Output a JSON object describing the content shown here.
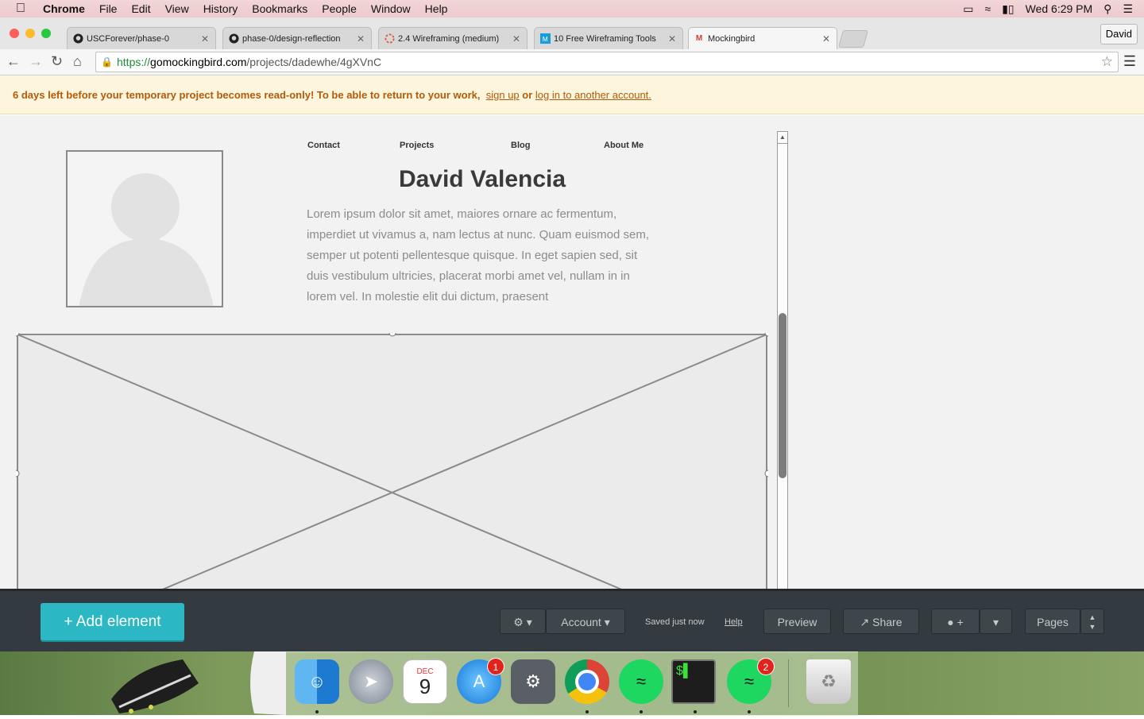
{
  "menubar": {
    "app": "Chrome",
    "items": [
      "File",
      "Edit",
      "View",
      "History",
      "Bookmarks",
      "People",
      "Window",
      "Help"
    ],
    "clock": "Wed 6:29 PM"
  },
  "tabs": [
    {
      "title": "USCForever/phase-0"
    },
    {
      "title": "phase-0/design-reflection"
    },
    {
      "title": "2.4 Wireframing (medium)"
    },
    {
      "title": "10 Free Wireframing Tools"
    },
    {
      "title": "Mockingbird"
    }
  ],
  "profile": "David",
  "address": {
    "scheme": "https://",
    "host": "gomockingbird.com",
    "path": "/projects/dadewhe/4gXVnC"
  },
  "banner": {
    "message": "6 days left before your temporary project becomes read-only! To be able to return to your work,",
    "signup": "sign up",
    "or": "or",
    "login": "log in to another account."
  },
  "wireframe": {
    "nav": [
      "Contact",
      "Projects",
      "Blog",
      "About Me"
    ],
    "name": "David Valencia",
    "bio": "Lorem ipsum dolor sit amet, maiores ornare ac fermentum, imperdiet ut vivamus a, nam lectus at nunc. Quam euismod sem, semper ut potenti pellentesque quisque. In eget sapien sed, sit duis vestibulum ultricies, placerat morbi amet vel, nullam in in lorem vel. In molestie elit dui dictum, praesent"
  },
  "bottombar": {
    "add": "+ Add element",
    "account": "Account",
    "saved": "Saved just now",
    "help": "Help",
    "preview": "Preview",
    "share": "Share",
    "comment_plus": "+",
    "pages": "Pages"
  },
  "dock": {
    "calendar_month": "DEC",
    "calendar_day": "9",
    "appstore_badge": "1",
    "spotify_badge": "2"
  },
  "colors": {
    "accent": "#2cb7c4",
    "banner_text": "#b35a0b",
    "banner_bg": "#fdf6dc",
    "toolbar_bg": "#333b40"
  }
}
